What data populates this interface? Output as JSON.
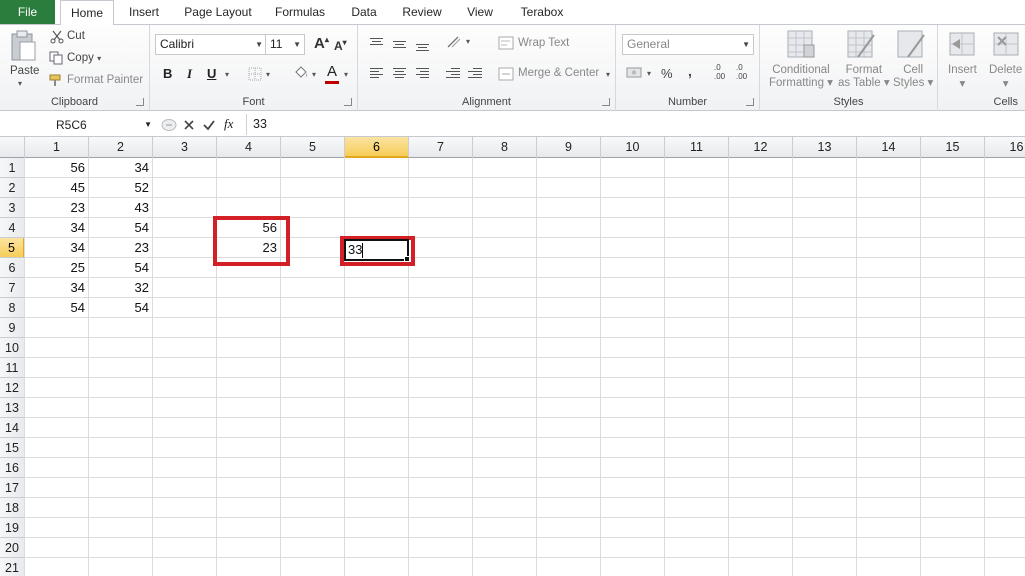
{
  "tabs": [
    "File",
    "Home",
    "Insert",
    "Page Layout",
    "Formulas",
    "Data",
    "Review",
    "View",
    "Terabox"
  ],
  "clipboard": {
    "paste": "Paste",
    "cut": "Cut",
    "copy": "Copy",
    "format_painter": "Format Painter",
    "label": "Clipboard"
  },
  "font": {
    "name": "Calibri",
    "size": "11",
    "bold": "B",
    "italic": "I",
    "underline": "U",
    "grow": "A",
    "shrink": "A",
    "color_letter": "A",
    "label": "Font",
    "color_accent": "#c00000"
  },
  "alignment": {
    "wrap_text": "Wrap Text",
    "merge_center": "Merge & Center",
    "label": "Alignment"
  },
  "number": {
    "format": "General",
    "percent": "%",
    "comma": ",",
    "dec_inc": ".0\n.00",
    "label": "Number"
  },
  "styles": {
    "conditional": "Conditional",
    "formatting": "Formatting",
    "format_as": "Format",
    "as_table": "as Table",
    "cell": "Cell",
    "cell_styles": "Styles",
    "label": "Styles"
  },
  "cells": {
    "insert": "Insert",
    "delete": "Delete",
    "label": "Cells"
  },
  "formula_bar": {
    "name_box": "R5C6",
    "fx": "fx",
    "value": "33"
  },
  "columns": [
    "1",
    "2",
    "3",
    "4",
    "5",
    "6",
    "7",
    "8",
    "9",
    "10",
    "11",
    "12",
    "13",
    "14",
    "15",
    "16"
  ],
  "selected_column": "6",
  "rows": [
    "1",
    "2",
    "3",
    "4",
    "5",
    "6",
    "7",
    "8",
    "9",
    "10",
    "11",
    "12",
    "13",
    "14",
    "15",
    "16",
    "17",
    "18",
    "19",
    "20",
    "21"
  ],
  "selected_row": "5",
  "col1": [
    "56",
    "45",
    "23",
    "34",
    "34",
    "25",
    "34",
    "54"
  ],
  "col2": [
    "34",
    "52",
    "43",
    "54",
    "23",
    "54",
    "32",
    "54"
  ],
  "col4": [
    "56",
    "23"
  ],
  "active_cell_value": "33",
  "colors": {
    "file_tab": "#2a7d3c",
    "highlight_box": "#d31f26",
    "selected_header": "#f7cd58"
  }
}
